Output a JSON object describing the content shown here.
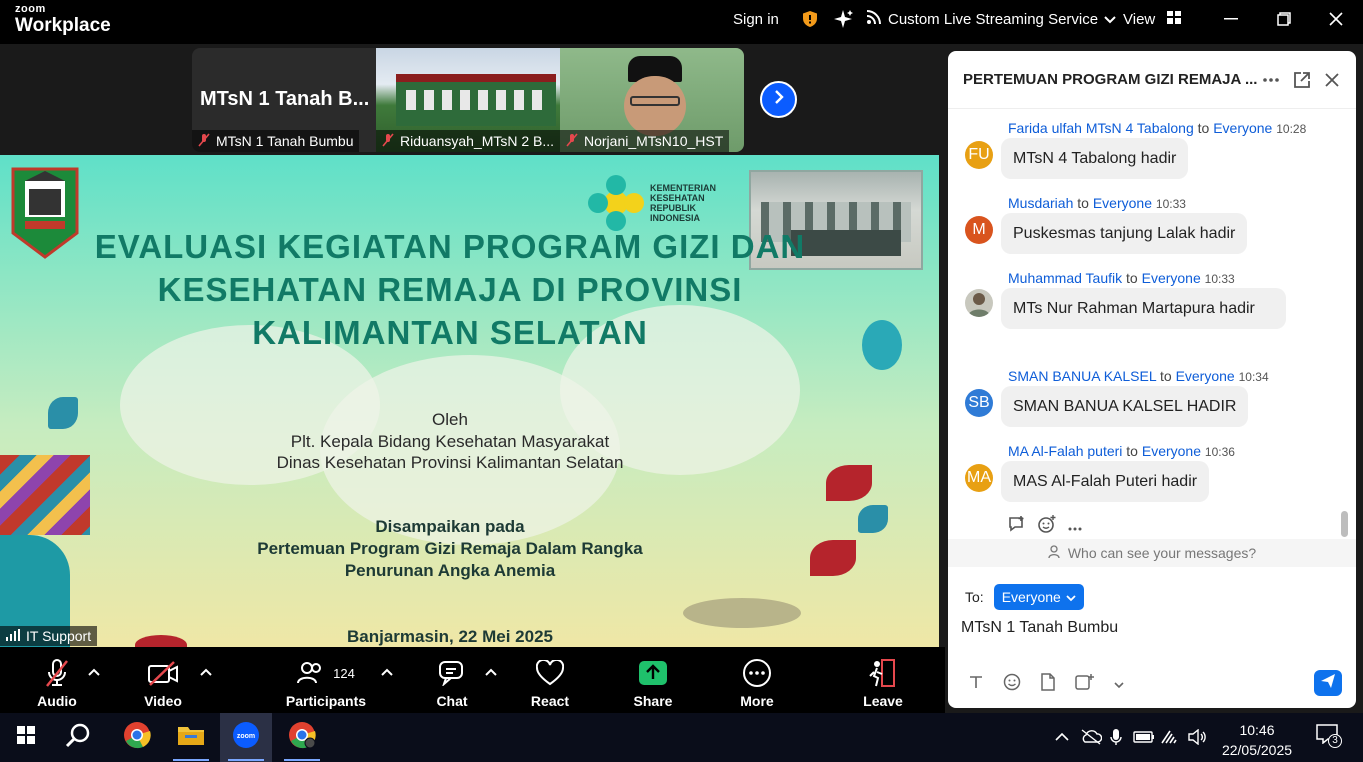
{
  "titlebar": {
    "brand_top": "zoom",
    "brand_bottom": "Workplace",
    "signin": "Sign in",
    "streaming": "Custom Live Streaming Service",
    "view": "View"
  },
  "strip": {
    "tiles": [
      {
        "big_name": "MTsN 1 Tanah B...",
        "caption": "MTsN 1 Tanah Bumbu"
      },
      {
        "caption": "Riduansyah_MTsN 2 B..."
      },
      {
        "caption": "Norjani_MTsN10_HST"
      }
    ]
  },
  "slide": {
    "title": [
      "EVALUASI KEGIATAN PROGRAM GIZI DAN",
      "KESEHATAN REMAJA DI PROVINSI",
      "KALIMANTAN SELATAN"
    ],
    "logo_text": [
      "KEMENTERIAN",
      "KESEHATAN",
      "REPUBLIK",
      "INDONESIA"
    ],
    "oleh": "Oleh",
    "presenter1": "Plt. Kepala Bidang Kesehatan Masyarakat",
    "presenter2": "Dinas Kesehatan Provinsi Kalimantan Selatan",
    "disampaikan": "Disampaikan pada",
    "event1": "Pertemuan Program Gizi Remaja Dalam Rangka",
    "event2": "Penurunan Angka Anemia",
    "place_date": "Banjarmasin, 22 Mei 2025",
    "speaker_label": "IT Support"
  },
  "toolbar": {
    "audio": "Audio",
    "video": "Video",
    "participants": "Participants",
    "participant_count": "124",
    "chat": "Chat",
    "react": "React",
    "share": "Share",
    "more": "More",
    "leave": "Leave"
  },
  "chat": {
    "title": "PERTEMUAN PROGRAM GIZI REMAJA ...",
    "messages": [
      {
        "initials": "FU",
        "color": "#e8a013",
        "name": "Farida ulfah MTsN 4 Tabalong",
        "to": "to",
        "recipient": "Everyone",
        "time": "10:28",
        "text": "MTsN 4 Tabalong hadir"
      },
      {
        "initials": "M",
        "color": "#d9541e",
        "name": "Musdariah",
        "to": "to",
        "recipient": "Everyone",
        "time": "10:33",
        "text": "Puskesmas tanjung Lalak hadir"
      },
      {
        "initials": "",
        "color": "#8a8f7a",
        "name": "Muhammad Taufik",
        "to": "to",
        "recipient": "Everyone",
        "time": "10:33",
        "text": "MTs Nur Rahman Martapura hadir"
      },
      {
        "initials": "SB",
        "color": "#2f7bd6",
        "name": "SMAN BANUA KALSEL",
        "to": "to",
        "recipient": "Everyone",
        "time": "10:34",
        "text": "SMAN BANUA KALSEL HADIR"
      },
      {
        "initials": "MA",
        "color": "#e8a013",
        "name": "MA Al-Falah puteri",
        "to": "to",
        "recipient": "Everyone",
        "time": "10:36",
        "text": "MAS Al-Falah Puteri hadir"
      }
    ],
    "privacy": "Who can see your messages?",
    "to_label": "To:",
    "to_value": "Everyone",
    "draft": "MTsN 1 Tanah Bumbu"
  },
  "taskbar": {
    "time": "10:46",
    "date": "22/05/2025",
    "notifications": "3"
  }
}
